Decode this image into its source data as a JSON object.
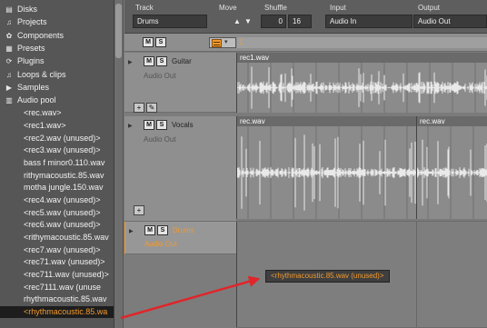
{
  "browser": {
    "categories": [
      {
        "label": "Disks",
        "icon": "disk-icon",
        "glyph": "▤"
      },
      {
        "label": "Projects",
        "icon": "projects-icon",
        "glyph": "♫"
      },
      {
        "label": "Components",
        "icon": "components-icon",
        "glyph": "✿"
      },
      {
        "label": "Presets",
        "icon": "presets-icon",
        "glyph": "▦"
      },
      {
        "label": "Plugins",
        "icon": "plugins-icon",
        "glyph": "⟳"
      },
      {
        "label": "Loops & clips",
        "icon": "loops-icon",
        "glyph": "♫"
      },
      {
        "label": "Samples",
        "icon": "samples-icon",
        "glyph": "▶"
      },
      {
        "label": "Audio pool",
        "icon": "audio-pool-icon",
        "glyph": "▥"
      }
    ],
    "files": [
      "<rec.wav>",
      "<rec1.wav>",
      "<rec2.wav (unused)>",
      "<rec3.wav (unused)>",
      "bass f minor0.110.wav",
      "rithymacoustic.85.wav",
      "motha jungle.150.wav",
      "<rec4.wav (unused)>",
      "<rec5.wav (unused)>",
      "<rec6.wav (unused)>",
      "<rithymacoustic.85.wav",
      "<rec7.wav (unused)>",
      "<rec71.wav (unused)>",
      "<rec711.wav (unused)>",
      "<rec7111.wav (unuse",
      "rhythmacoustic.85.wav",
      "<rhythmacoustic.85.wa"
    ],
    "selected_index": 16
  },
  "header": {
    "track_label": "Track",
    "track_value": "Drums",
    "move_label": "Move",
    "move_up": "▲",
    "move_down": "▼",
    "shuffle_label": "Shuffle",
    "shuffle_value": "0",
    "shuffle_grid": "16",
    "input_label": "Input",
    "input_value": "Audio In",
    "output_label": "Output",
    "output_value": "Audio Out"
  },
  "toolbar": {
    "mute": "M",
    "solo": "S",
    "snap_dropdown": "▾",
    "ruler_marks": [
      "1"
    ]
  },
  "tracks": [
    {
      "name": "Guitar",
      "output": "Audio Out",
      "mute": "M",
      "solo": "S",
      "selected": false
    },
    {
      "name": "Vocals",
      "output": "Audio Out",
      "mute": "M",
      "solo": "S",
      "selected": false
    },
    {
      "name": "Drums",
      "output": "Audio Out",
      "mute": "M",
      "solo": "S",
      "selected": true
    }
  ],
  "track_buttons": {
    "add": "+",
    "edit": "✎"
  },
  "clips": {
    "guitar": [
      "rec1.wav"
    ],
    "vocals": [
      "rec.wav",
      "rec.wav"
    ]
  },
  "drop_tooltip": "<rhythmacoustic.85.wav (unused)>",
  "colors": {
    "accent": "#f29a2e",
    "annotation": "#e0262a"
  }
}
